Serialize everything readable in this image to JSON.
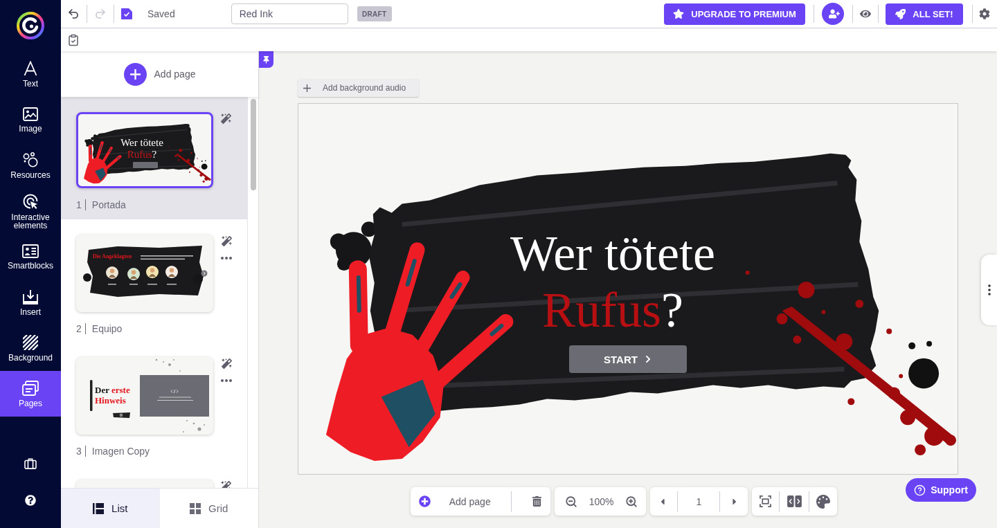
{
  "sidebar": {
    "items": [
      {
        "label": "Text",
        "selected": false
      },
      {
        "label": "Image",
        "selected": false
      },
      {
        "label": "Resources",
        "selected": false
      },
      {
        "label": "Interactive elements",
        "selected": false
      },
      {
        "label": "Smartblocks",
        "selected": false
      },
      {
        "label": "Insert",
        "selected": false
      },
      {
        "label": "Background",
        "selected": false
      },
      {
        "label": "Pages",
        "selected": true
      }
    ]
  },
  "toolbar": {
    "undo_disabled": false,
    "redo_disabled": true,
    "saved_checked": true,
    "status": "Saved",
    "title_field": {
      "value": "Red Ink"
    },
    "draft_badge": "DRAFT",
    "upgrade_button": "UPGRADE TO PREMIUM",
    "publish_button": "ALL SET!"
  },
  "pages_panel": {
    "add_page": "Add page",
    "pages": [
      {
        "number": "1",
        "title": "Portada",
        "selected": true,
        "has_menu": false,
        "thumbnail": {
          "kind": "cover",
          "title": "Wer tötete",
          "highlight": "Rufus",
          "mark": "?"
        }
      },
      {
        "number": "2",
        "title": "Equipo",
        "selected": false,
        "has_menu": true,
        "thumbnail": {
          "kind": "team",
          "title": "Die Angeklagten"
        }
      },
      {
        "number": "3",
        "title": "Imagen Copy",
        "selected": false,
        "has_menu": true,
        "thumbnail": {
          "kind": "clue",
          "title": "Der",
          "highlight": "erste Hinweis"
        }
      },
      {
        "selected": false,
        "has_menu": false,
        "thumbnail": {
          "kind": "blank"
        }
      }
    ],
    "view_tabs": [
      {
        "label": "List",
        "selected": true
      },
      {
        "label": "Grid",
        "selected": false
      }
    ]
  },
  "canvas": {
    "audio_button": "Add background audio",
    "slide": {
      "title": "Wer tötete",
      "highlight": "Rufus",
      "mark": "?",
      "button": "START"
    }
  },
  "bottom_toolbar": {
    "add_page": "Add page",
    "zoom": "100%",
    "page": "1"
  },
  "support_button": "Support"
}
